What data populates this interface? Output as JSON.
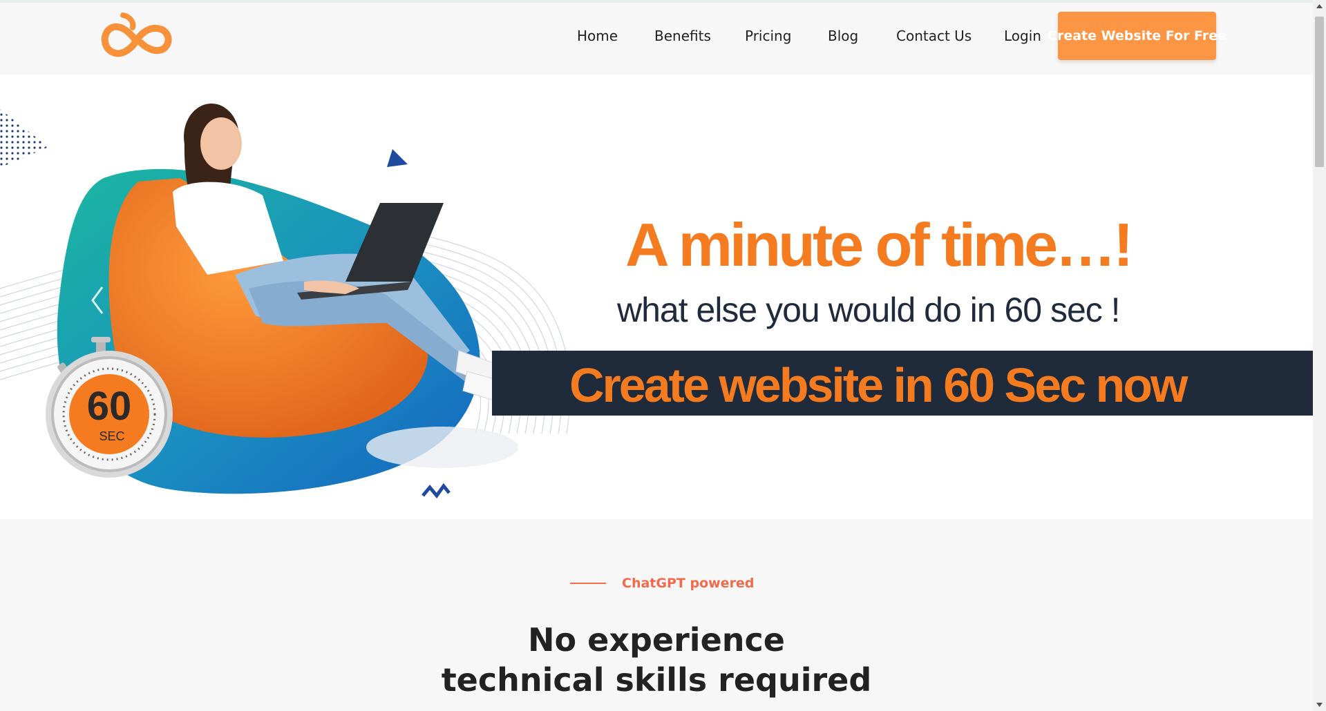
{
  "colors": {
    "brand_orange": "#f47b20",
    "cta_orange": "#fd9644",
    "navy": "#1f2a3a",
    "accent_red": "#f26a4b",
    "teal": "#1bb7a0",
    "blue": "#1565c0"
  },
  "header": {
    "logo_icon": "infinity-logo-icon",
    "nav": [
      {
        "label": "Home"
      },
      {
        "label": "Benefits"
      },
      {
        "label": "Pricing"
      },
      {
        "label": "Blog"
      },
      {
        "label": "Contact Us"
      },
      {
        "label": "Login"
      }
    ],
    "cta_label": "Create Website For Free"
  },
  "hero": {
    "headline": "A minute of time…!",
    "subline": "what else you would do in 60 sec !",
    "banner": "Create website in 60 Sec now",
    "stopwatch": {
      "number": "60",
      "unit": "SEC"
    },
    "prev_icon": "chevron-left-icon"
  },
  "features": {
    "eyebrow": "ChatGPT powered",
    "title_line1": "No experience",
    "title_line2": "technical skills required"
  }
}
